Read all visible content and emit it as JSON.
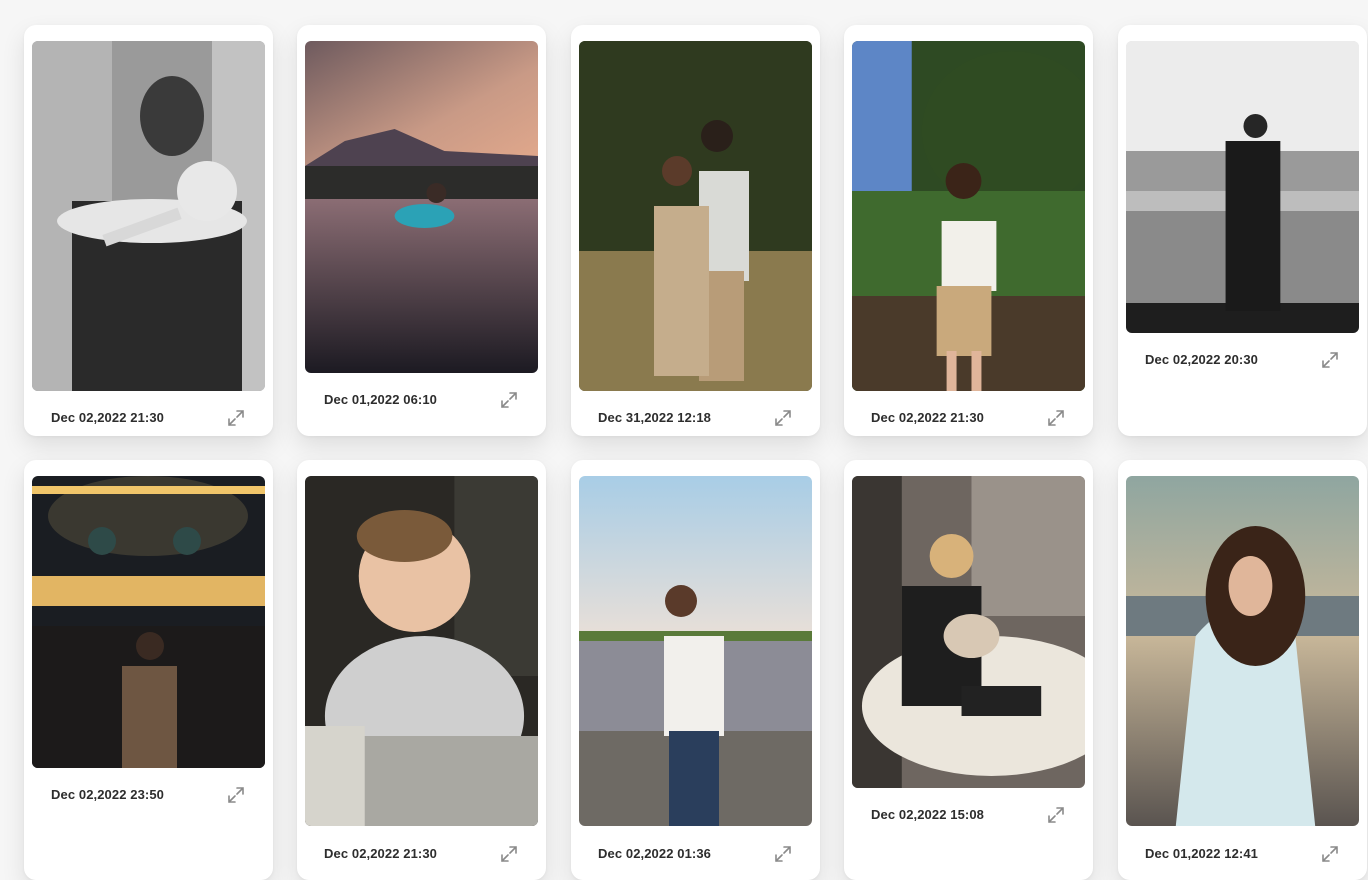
{
  "gallery": {
    "items": [
      {
        "date": "Dec 02,2022 21:30",
        "photo": "couple-embrace-bw"
      },
      {
        "date": "Dec 01,2022 06:10",
        "photo": "woman-sitting-in-lake-sunset"
      },
      {
        "date": "Dec 31,2022 12:18",
        "photo": "couple-in-field"
      },
      {
        "date": "Dec 02,2022 21:30",
        "photo": "woman-in-garden"
      },
      {
        "date": "Dec 02,2022 20:30",
        "photo": "man-on-bridge-bw"
      },
      {
        "date": "Dec 02,2022 23:50",
        "photo": "mosque-interior-crowd"
      },
      {
        "date": "Dec 02,2022 21:30",
        "photo": "smiling-baby"
      },
      {
        "date": "Dec 02,2022 01:36",
        "photo": "woman-by-lake-pebbles"
      },
      {
        "date": "Dec 02,2022 15:08",
        "photo": "woman-with-cat-on-sofa"
      },
      {
        "date": "Dec 01,2022 12:41",
        "photo": "woman-windblown-hair"
      }
    ]
  },
  "icons": {
    "expand": "expand-icon"
  },
  "colors": {
    "card": "#ffffff",
    "date_text": "#2d2d2d",
    "icon": "#8a8a8a",
    "background": "#f6f6f6"
  }
}
